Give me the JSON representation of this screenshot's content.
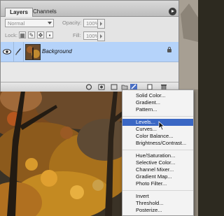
{
  "palette": {
    "tabs": [
      "Layers",
      "Channels"
    ],
    "blend_mode": "Normal",
    "opacity_label": "Opacity:",
    "opacity_value": "100%",
    "lock_label": "Lock:",
    "fill_label": "Fill:",
    "fill_value": "100%",
    "layer": {
      "name": "Background"
    }
  },
  "menu": {
    "items": [
      "Solid Color...",
      "Gradient...",
      "Pattern...",
      "Levels...",
      "Curves...",
      "Color Balance...",
      "Brightness/Contrast...",
      "Hue/Saturation...",
      "Selective Color...",
      "Channel Mixer...",
      "Gradient Map...",
      "Photo Filter...",
      "Invert",
      "Threshold...",
      "Posterize..."
    ],
    "selected": "Levels..."
  },
  "colors": {
    "selection": "#3a67c4",
    "layer_highlight": "#b5d3fa"
  }
}
